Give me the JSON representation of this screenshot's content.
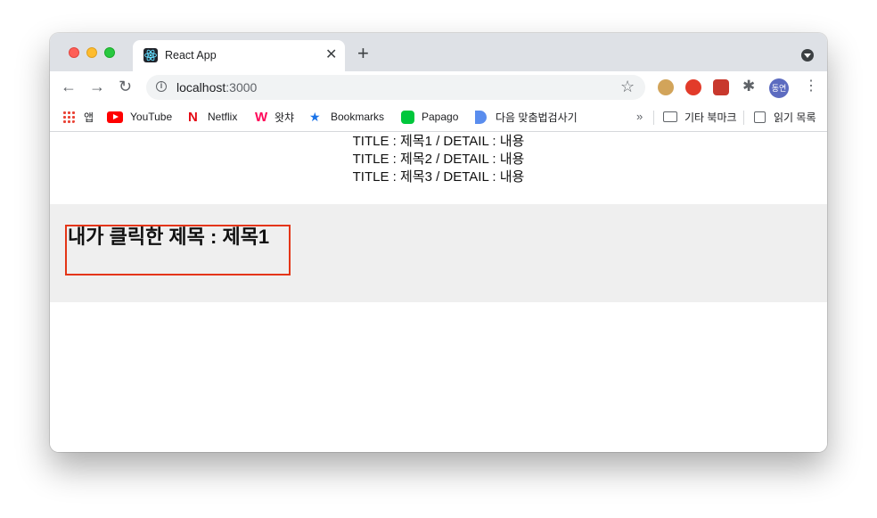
{
  "browser": {
    "tab": {
      "title": "React App"
    },
    "url": {
      "host": "localhost",
      "port": ":3000"
    },
    "profile_label": "동연",
    "bookmarks": [
      {
        "label": "앱",
        "icon": "apps-grid-icon"
      },
      {
        "label": "YouTube",
        "icon": "youtube-icon"
      },
      {
        "label": "Netflix",
        "icon": "netflix-icon"
      },
      {
        "label": "왓챠",
        "icon": "watcha-icon"
      },
      {
        "label": "Bookmarks",
        "icon": "star-icon"
      },
      {
        "label": "Papago",
        "icon": "papago-icon"
      },
      {
        "label": "다음 맞춤법검사기",
        "icon": "daum-icon"
      }
    ],
    "overflow_label": "»",
    "other_bookmarks": "기타 북마크",
    "reading_list": "읽기 목록"
  },
  "page": {
    "items": [
      {
        "text": "TITLE : 제목1 / DETAIL : 내용"
      },
      {
        "text": "TITLE : 제목2 / DETAIL : 내용"
      },
      {
        "text": "TITLE : 제목3 / DETAIL : 내용"
      }
    ],
    "selected_heading": "내가 클릭한 제목 : 제목1"
  },
  "colors": {
    "highlight_border": "#e43516",
    "panel_background": "#efefef"
  }
}
